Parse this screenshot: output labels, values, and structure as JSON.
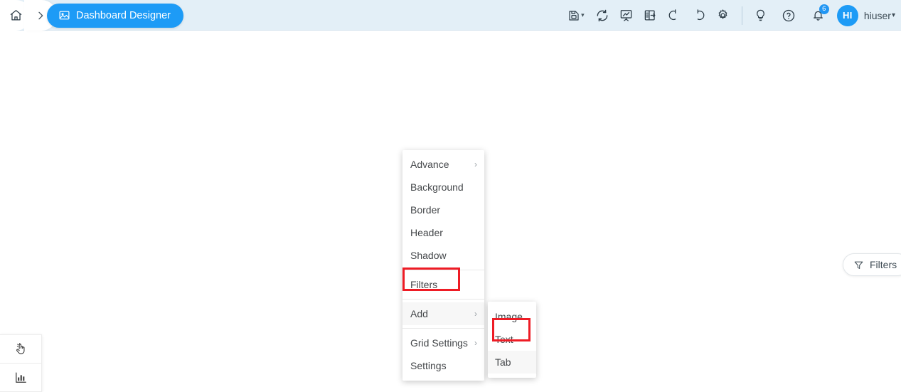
{
  "header": {
    "home_icon": "home-icon",
    "separator_icon": "chevron-right-icon",
    "breadcrumb_active": {
      "icon": "image-dashboard-icon",
      "label": "Dashboard Designer"
    },
    "tools": [
      {
        "name": "save-dropdown-button",
        "icon": "floppy-disk-icon",
        "caret": "⌄"
      },
      {
        "name": "refresh-button",
        "icon": "refresh-circular-arrows-icon"
      },
      {
        "name": "presentation-button",
        "icon": "presentation-chart-icon"
      },
      {
        "name": "panel-toggle-button",
        "icon": "panel-layout-icon"
      },
      {
        "name": "undo-button",
        "icon": "undo-arrow-icon"
      },
      {
        "name": "redo-button",
        "icon": "redo-arrow-icon"
      },
      {
        "name": "settings-button",
        "icon": "gear-icon"
      }
    ],
    "tools_right": [
      {
        "name": "tips-button",
        "icon": "lightbulb-icon"
      },
      {
        "name": "help-button",
        "icon": "question-circle-icon"
      }
    ],
    "notifications": {
      "icon": "bell-icon",
      "count": "6"
    },
    "user": {
      "avatar_initials": "HI",
      "name": "hiuser",
      "caret": "⌄"
    }
  },
  "canvas": {
    "filters_button": {
      "icon": "funnel-filter-icon",
      "label": "Filters"
    },
    "tool_rail": [
      {
        "name": "rail-item-pointer",
        "icon": "hand-pointer-icon"
      },
      {
        "name": "rail-item-chart",
        "icon": "bar-chart-icon"
      }
    ]
  },
  "context_menu": {
    "items": [
      {
        "label": "Advance",
        "has_submenu": true,
        "arrow": "›",
        "highlighted": false
      },
      {
        "label": "Background",
        "has_submenu": false,
        "arrow": "",
        "highlighted": false
      },
      {
        "label": "Border",
        "has_submenu": false,
        "arrow": "",
        "highlighted": false
      },
      {
        "label": "Header",
        "has_submenu": false,
        "arrow": "",
        "highlighted": false
      },
      {
        "label": "Shadow",
        "has_submenu": false,
        "arrow": "",
        "highlighted": false
      },
      {
        "label": "Filters",
        "has_submenu": false,
        "arrow": "",
        "highlighted": false
      },
      {
        "label": "Add",
        "has_submenu": true,
        "arrow": "›",
        "highlighted": true
      },
      {
        "label": "Grid Settings",
        "has_submenu": true,
        "arrow": "›",
        "highlighted": false
      },
      {
        "label": "Settings",
        "has_submenu": false,
        "arrow": "",
        "highlighted": false
      }
    ]
  },
  "sub_menu": {
    "items": [
      {
        "label": "Image",
        "highlighted": false
      },
      {
        "label": "Text",
        "highlighted": false
      },
      {
        "label": "Tab",
        "highlighted": true
      }
    ]
  },
  "annotations": {
    "highlight_color": "#ee1c25",
    "boxes": [
      {
        "name": "add-menu-item-highlight",
        "target": "Add"
      },
      {
        "name": "tab-menu-item-highlight",
        "target": "Tab"
      }
    ]
  },
  "colors": {
    "header_bg": "#e3eff7",
    "accent_blue": "#1d9bf6",
    "badge_blue": "#2196f3",
    "menu_text": "#44474a",
    "highlight_red": "#ee1c25"
  }
}
